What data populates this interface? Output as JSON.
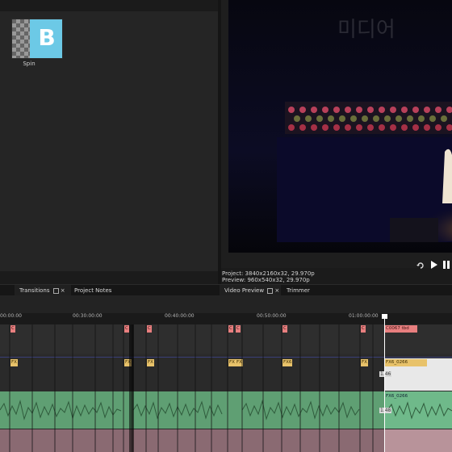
{
  "assets": {
    "transition_thumb_label": "Spin",
    "thumb_glyph": "B"
  },
  "project_info": {
    "project_line": "Project:  3840x2160x32, 29.970p",
    "preview_line": "Preview:  960x540x32, 29.970p"
  },
  "transport": {
    "loop_icon": "loop-icon",
    "play_icon": "play-icon",
    "pause_icon": "pause-icon"
  },
  "tabs": {
    "transitions": "Transitions",
    "project_notes": "Project Notes",
    "video_preview": "Video Preview",
    "trimmer": "Trimmer"
  },
  "ruler_labels": [
    "00:00:00",
    "00:30:00:00",
    "00:40:00:00",
    "00:50:00:00",
    "01:00:00:00"
  ],
  "events": {
    "red_clip_name": "C0067 tbd",
    "fx_clip_name": "FX6_0266",
    "fx_clip_small": "FX6",
    "audio_clip_name": "FX6_0266",
    "fx_marker": "FX",
    "c_marker": "C",
    "counter_a": "1.46",
    "counter_b": "1.48"
  },
  "colors": {
    "red_marker": "#e87f7f",
    "yellow_marker": "#e8c26a",
    "waveform_green": "#6fb98a",
    "cursor": "#ffffff"
  }
}
